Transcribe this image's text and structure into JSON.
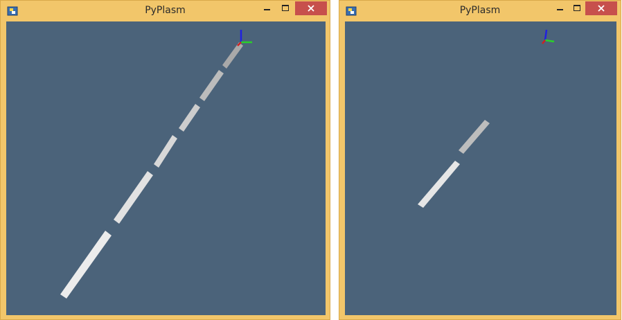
{
  "windows": [
    {
      "title": "PyPlasm",
      "controls": {
        "minimize": "minimize-icon",
        "maximize": "maximize-icon",
        "close": "close-icon"
      }
    },
    {
      "title": "PyPlasm",
      "controls": {
        "minimize": "minimize-icon",
        "maximize": "maximize-icon",
        "close": "close-icon"
      }
    }
  ],
  "colors": {
    "titlebar": "#f2c66a",
    "viewport": "#4b637a",
    "close": "#c7504c",
    "axis_x": "#d02020",
    "axis_y": "#2ad02a",
    "axis_z": "#2020e0"
  }
}
